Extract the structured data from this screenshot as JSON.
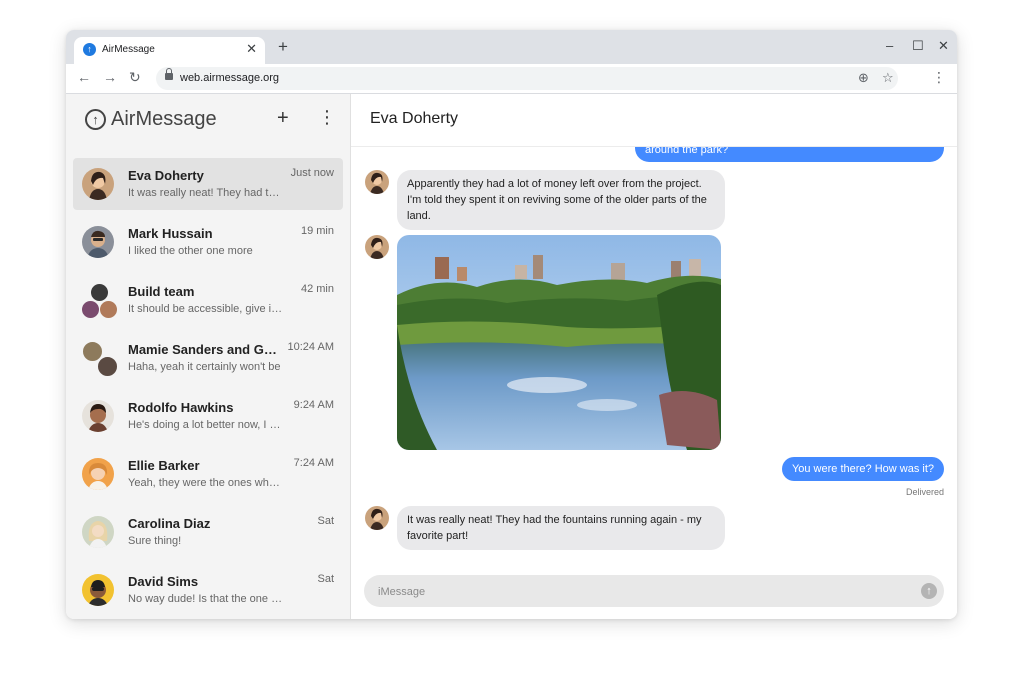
{
  "browser": {
    "tab_title": "AirMessage",
    "tab_close": "✕",
    "new_tab": "+",
    "url": "web.airmessage.org",
    "window_controls": {
      "minimize": "–",
      "maximize": "☐",
      "close": "✕"
    },
    "icons": {
      "back": "←",
      "forward": "→",
      "reload": "↻",
      "install": "⊕",
      "star": "☆",
      "menu": "⋮"
    }
  },
  "sidebar": {
    "app_name": "AirMessage",
    "new_icon": "+",
    "more_icon": "⋮",
    "conversations": [
      {
        "name": "Eva Doherty",
        "preview": "It was really neat! They had the fountains running again - my favorite part!",
        "time": "Just now",
        "selected": true
      },
      {
        "name": "Mark Hussain",
        "preview": "I liked the other one more",
        "time": "19 min"
      },
      {
        "name": "Build team",
        "preview": "It should be accessible, give it a try",
        "time": "42 min"
      },
      {
        "name": "Mamie Sanders and Garrett",
        "preview": "Haha, yeah it certainly won't be",
        "time": "10:24 AM"
      },
      {
        "name": "Rodolfo Hawkins",
        "preview": "He's doing a lot better now, I think",
        "time": "9:24 AM"
      },
      {
        "name": "Ellie Barker",
        "preview": "Yeah, they were the ones who told me",
        "time": "7:24 AM"
      },
      {
        "name": "Carolina Diaz",
        "preview": "Sure thing!",
        "time": "Sat"
      },
      {
        "name": "David Sims",
        "preview": "No way dude! Is that the one you got",
        "time": "Sat"
      }
    ]
  },
  "chat": {
    "title": "Eva Doherty",
    "messages": {
      "out_partial": "around the park?",
      "in_1": "Apparently they had a lot of money left over from the project. I'm told they spent it on reviving some of the older parts of the land.",
      "out_1": "You were there? How was it?",
      "status": "Delivered",
      "in_2": "It was really neat! They had the fountains running again - my favorite part!"
    },
    "input_placeholder": "iMessage",
    "send_icon": "↑"
  },
  "colors": {
    "accent": "#448aff",
    "sidebar_bg": "#f4f4f4",
    "incoming_bubble": "#e9e9eb"
  }
}
